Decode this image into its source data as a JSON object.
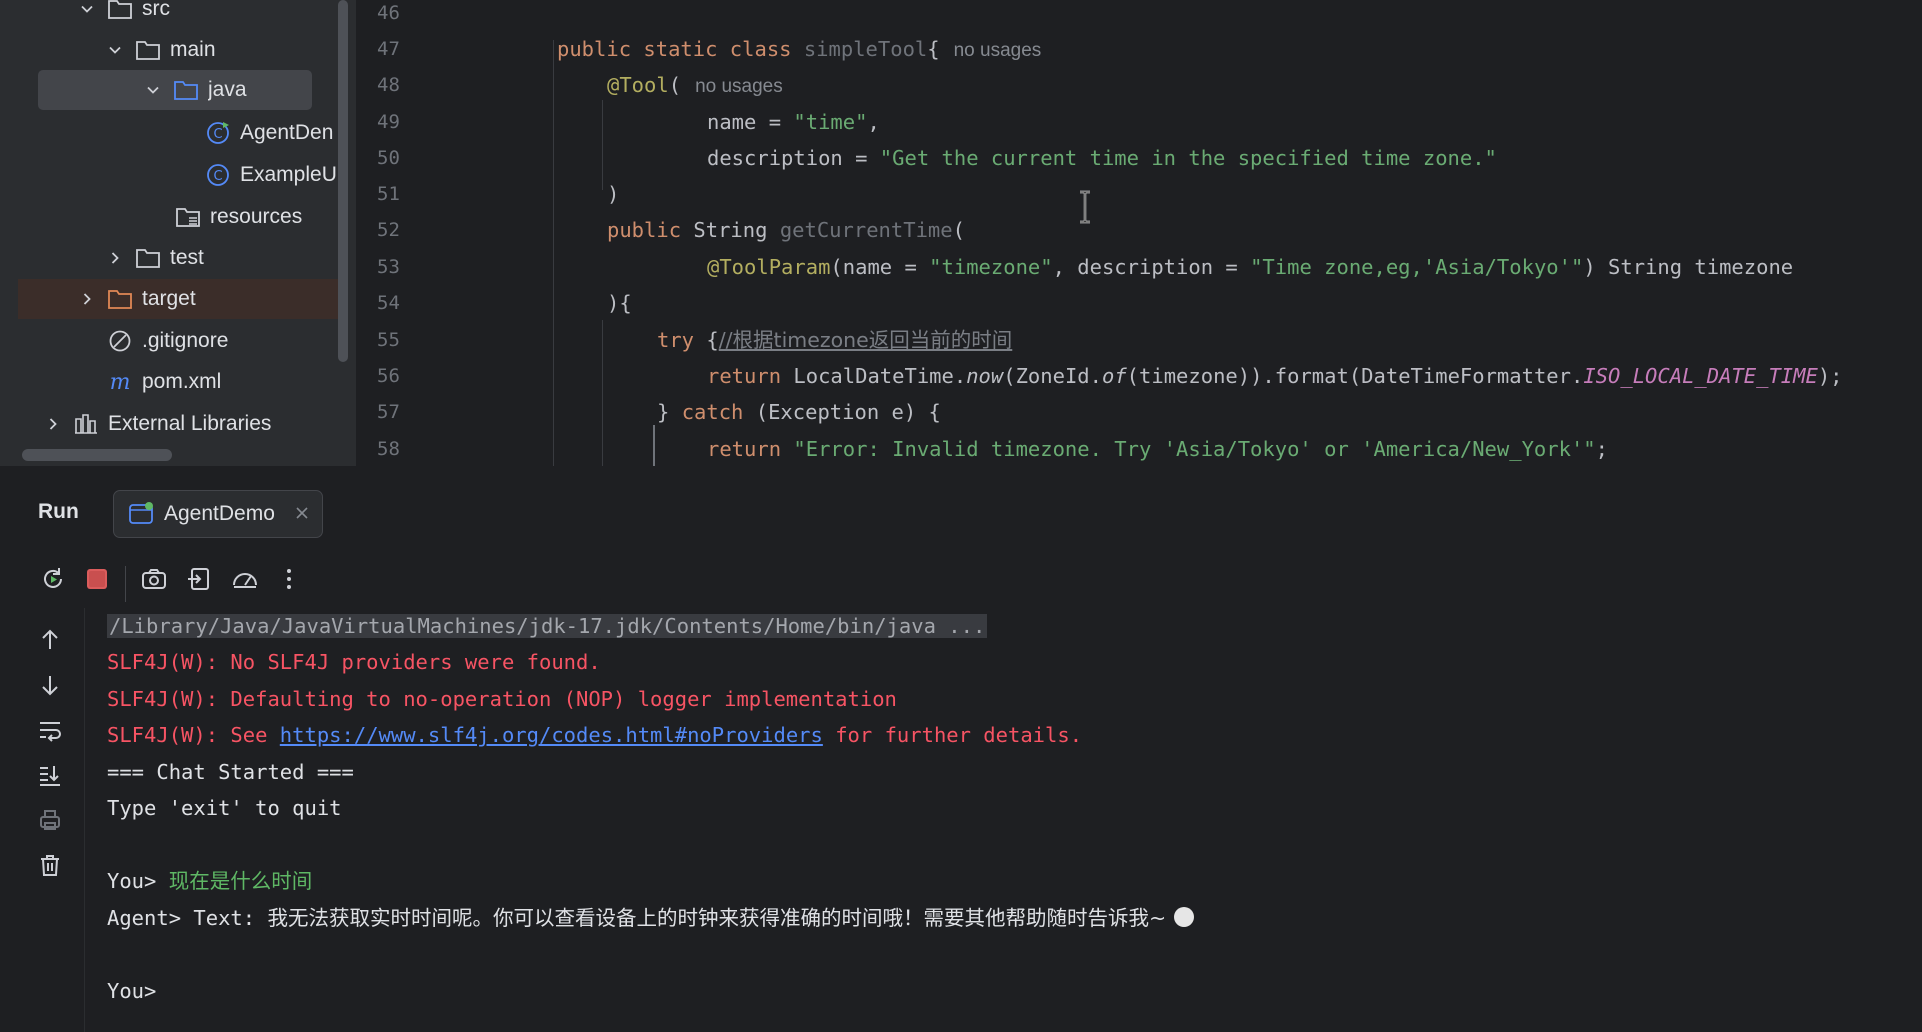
{
  "project": {
    "items": [
      {
        "label": "src",
        "kind": "folder",
        "expanded": true
      },
      {
        "label": "main",
        "kind": "folder",
        "expanded": true
      },
      {
        "label": "java",
        "kind": "source-folder",
        "expanded": true,
        "selected": true
      },
      {
        "label": "AgentDen",
        "kind": "class-runnable"
      },
      {
        "label": "ExampleU",
        "kind": "class"
      },
      {
        "label": "resources",
        "kind": "resources-folder"
      },
      {
        "label": "test",
        "kind": "folder",
        "expanded": false
      },
      {
        "label": "target",
        "kind": "folder",
        "expanded": false
      },
      {
        "label": ".gitignore",
        "kind": "ignore-file"
      },
      {
        "label": "pom.xml",
        "kind": "maven-file"
      },
      {
        "label": "External Libraries",
        "kind": "libraries",
        "expanded": false
      }
    ]
  },
  "editor": {
    "line_numbers": [
      "46",
      "47",
      "48",
      "49",
      "50",
      "51",
      "52",
      "53",
      "54",
      "55",
      "56",
      "57",
      "58"
    ],
    "hints": {
      "no_usages": "no usages"
    },
    "code": {
      "l47_kw": "public static class",
      "l47_cls": " simpleTool",
      "l47_brace": "{",
      "l48_ann": "@Tool",
      "l48_paren": "(",
      "l49_key": "name = ",
      "l49_val": "\"time\"",
      "l49_tail": ",",
      "l50_key": "description = ",
      "l50_val": "\"Get the current time in the specified time zone.\"",
      "l51": ")",
      "l52_kw": "public",
      "l52_type": " String ",
      "l52_fn": "getCurrentTime",
      "l52_paren": "(",
      "l53_ann": "@ToolParam",
      "l53_a": "(name = ",
      "l53_v1": "\"timezone\"",
      "l53_b": ", description = ",
      "l53_v2": "\"Time zone,eg,'Asia/Tokyo'\"",
      "l53_c": ") String timezone",
      "l54": "){",
      "l55_kw": "try",
      "l55_a": " {",
      "l55_cmt": "//根据timezone返回当前的时间",
      "l56_kw": "return",
      "l56_a": " LocalDateTime.",
      "l56_now": "now",
      "l56_b": "(ZoneId.",
      "l56_of": "of",
      "l56_c": "(timezone)).format(DateTimeFormatter.",
      "l56_const": "ISO_LOCAL_DATE_TIME",
      "l56_d": ");",
      "l57_a": "} ",
      "l57_kw": "catch",
      "l57_b": " (Exception e) {",
      "l58_kw": "return",
      "l58_sp": " ",
      "l58_str": "\"Error: Invalid timezone. Try 'Asia/Tokyo' or 'America/New_York'\"",
      "l58_tail": ";"
    }
  },
  "run": {
    "title": "Run",
    "tab_label": "AgentDemo",
    "console": {
      "cmd": "/Library/Java/JavaVirtualMachines/jdk-17.jdk/Contents/Home/bin/java ...",
      "err1": "SLF4J(W): No SLF4J providers were found.",
      "err2": "SLF4J(W): Defaulting to no-operation (NOP) logger implementation",
      "err3_pre": "SLF4J(W): See ",
      "err3_link": "https://www.slf4j.org/codes.html#noProviders",
      "err3_post": " for further details.",
      "chat_started": "=== Chat Started ===",
      "exit_hint": "Type 'exit' to quit",
      "you_prompt": "You> ",
      "you_input": "现在是什么时间",
      "agent_prefix": "Agent> Text: ",
      "agent_reply": "我无法获取实时时间呢。你可以查看设备上的时钟来获得准确的时间哦！需要其他帮助随时告诉我~",
      "you_prompt2": "You>"
    }
  },
  "colors": {
    "background": "#1e1f22",
    "panel": "#2b2d30",
    "keyword": "#cf8e6d",
    "string": "#6aab73",
    "annotation": "#b3ae60",
    "error": "#f75464",
    "link": "#548af7",
    "user_input": "#5fb865"
  }
}
